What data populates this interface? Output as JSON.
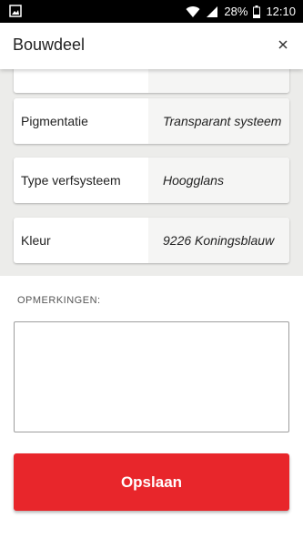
{
  "status_bar": {
    "battery": "28%",
    "time": "12:10",
    "icons": [
      "image-icon",
      "wifi-icon",
      "signal-icon",
      "battery-icon"
    ]
  },
  "app_bar": {
    "title": "Bouwdeel",
    "close_icon": "×"
  },
  "fields": [
    {
      "label": "Pigmentatie",
      "value": "Transparant systeem"
    },
    {
      "label": "Type verfsysteem",
      "value": "Hoogglans"
    },
    {
      "label": "Kleur",
      "value": "9226 Koningsblauw"
    }
  ],
  "remarks": {
    "label": "OPMERKINGEN:",
    "value": ""
  },
  "save_button": {
    "label": "Opslaan"
  },
  "colors": {
    "accent": "#e8262b",
    "background_grey": "#ececea",
    "status_bar": "#000000"
  }
}
